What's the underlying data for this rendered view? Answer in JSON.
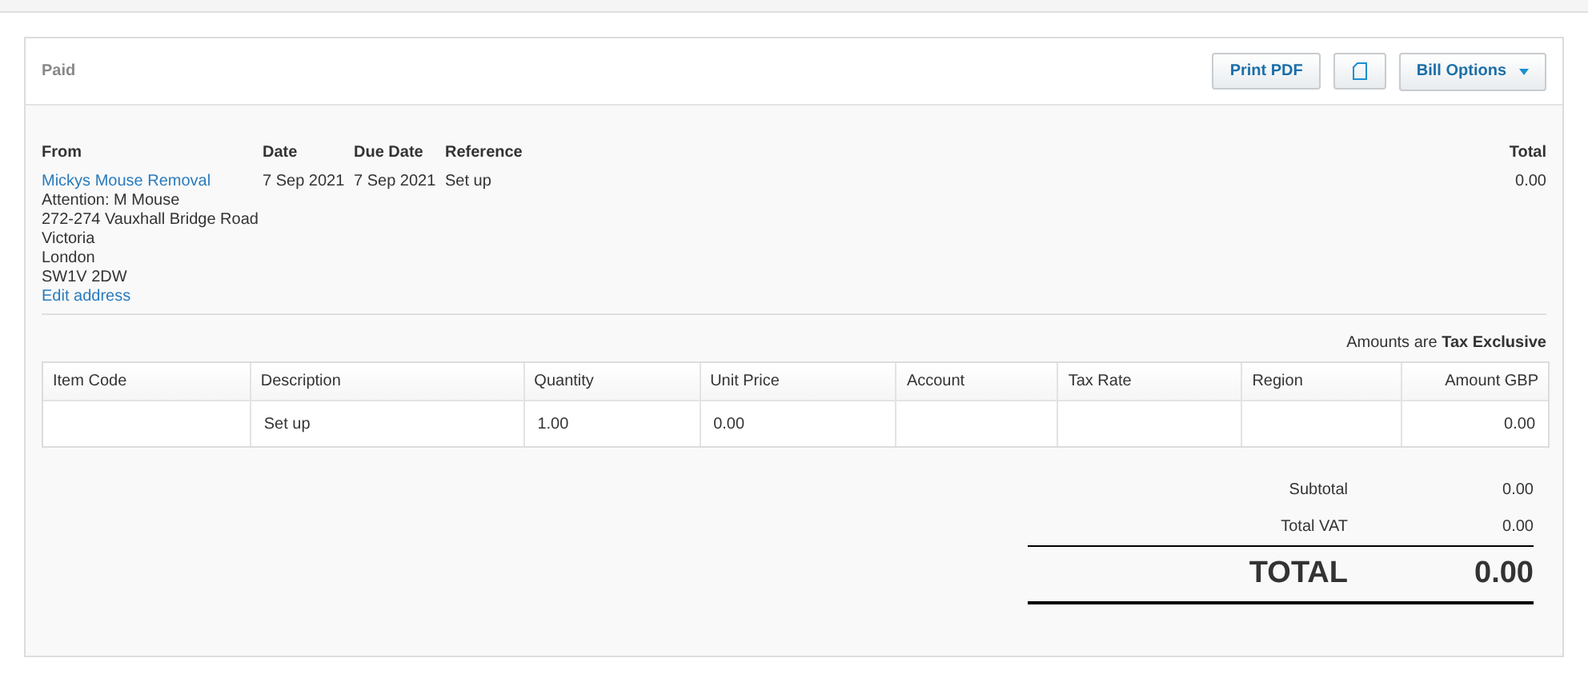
{
  "status": "Paid",
  "toolbar": {
    "print_button": "Print PDF",
    "options_button": "Bill Options"
  },
  "details": {
    "from_label": "From",
    "from_name": "Mickys Mouse Removal",
    "address_lines": [
      "Attention: M Mouse",
      "272-274 Vauxhall Bridge Road",
      "Victoria",
      "London",
      "SW1V 2DW"
    ],
    "edit_link": "Edit address",
    "date_label": "Date",
    "date": "7 Sep 2021",
    "due_label": "Due Date",
    "due": "7 Sep 2021",
    "reference_label": "Reference",
    "reference": "Set up",
    "total_label": "Total",
    "total": "0.00"
  },
  "tax_note": "Amounts are **Tax Exclusive**",
  "table": {
    "columns": [
      "Item Code",
      "Description",
      "Quantity",
      "Unit Price",
      "Account",
      "Tax Rate",
      "Region",
      "Amount GBP"
    ],
    "rows": [
      [
        "",
        "Set up",
        "1.00",
        "0.00",
        "",
        "",
        "",
        "0.00"
      ]
    ]
  },
  "totals": {
    "subtotal_label": "Subtotal",
    "subtotal": "0.00",
    "vat_label": "Total VAT",
    "vat": "0.00",
    "total_label": "TOTAL",
    "total": "0.00"
  }
}
